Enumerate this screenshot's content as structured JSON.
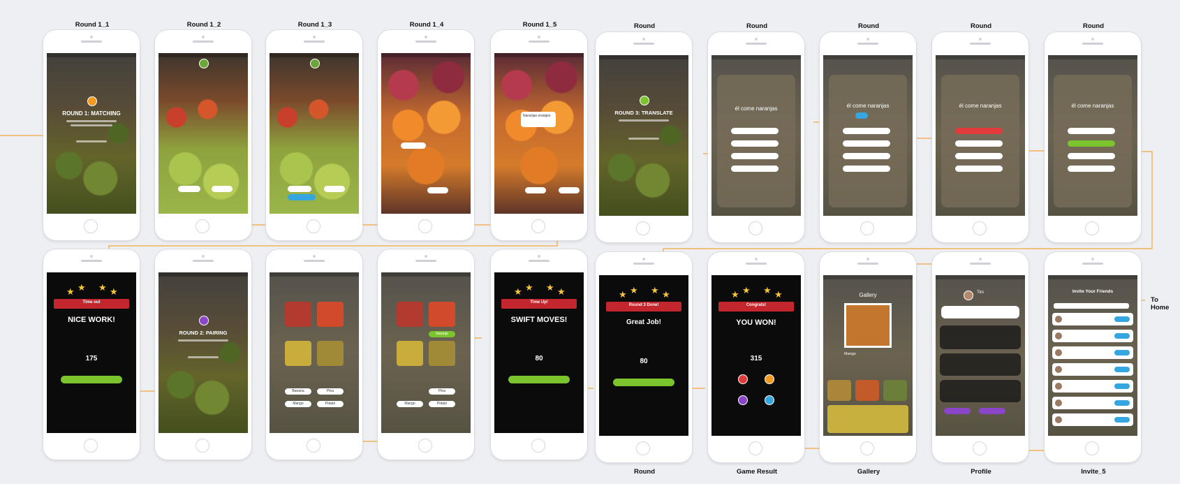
{
  "labels": {
    "row1": [
      "Round 1_1",
      "Round 1_2",
      "Round 1_3",
      "Round 1_4",
      "Round 1_5",
      "Round",
      "Round",
      "Round",
      "Round",
      "Round"
    ],
    "row2": [
      "Round",
      "Game Result",
      "Gallery",
      "Profile",
      "Invite_5"
    ],
    "to_home": "To\nHome"
  },
  "screens": {
    "r1s1": {
      "title": "ROUND 1: MATCHING"
    },
    "r1s5": {
      "tag": "Naranjas oranges"
    },
    "r1s6": {
      "title": "ROUND 3: TRANSLATE"
    },
    "r1s7": {
      "phrase": "él come naranjas"
    },
    "r1s8": {
      "phrase": "él come naranjas"
    },
    "r1s9": {
      "phrase": "él come naranjas"
    },
    "r1s10": {
      "phrase": "él come naranjas"
    },
    "r2s1": {
      "ribbon": "Time out",
      "headline": "NICE WORK!",
      "score": "175"
    },
    "r2s2": {
      "title": "ROUND 2: PAIRING"
    },
    "r2s3": {
      "labels": [
        "Banana",
        "Pina",
        "Mango",
        "Potato"
      ]
    },
    "r2s4": {
      "tag": "Naranja",
      "labels": [
        "Pina",
        "Mango",
        "Potato"
      ]
    },
    "r2s5": {
      "ribbon": "Time Up!",
      "headline": "SWIFT MOVES!",
      "score": "80"
    },
    "r2s6": {
      "ribbon": "Round 3 Done!",
      "headline": "Great Job!",
      "score": "80"
    },
    "r2s7": {
      "ribbon": "Congrats!",
      "headline": "YOU WON!",
      "score": "315"
    },
    "r2s8": {
      "title": "Gallery",
      "item": "Mango"
    },
    "r2s9": {
      "name": "Tim"
    },
    "r2s10": {
      "title": "Invite Your Friends"
    }
  },
  "colors": {
    "connector": "#f0a640",
    "accent_green": "#7cc42e",
    "ribbon_red": "#c4262e",
    "invite_blue": "#36a6e0"
  }
}
